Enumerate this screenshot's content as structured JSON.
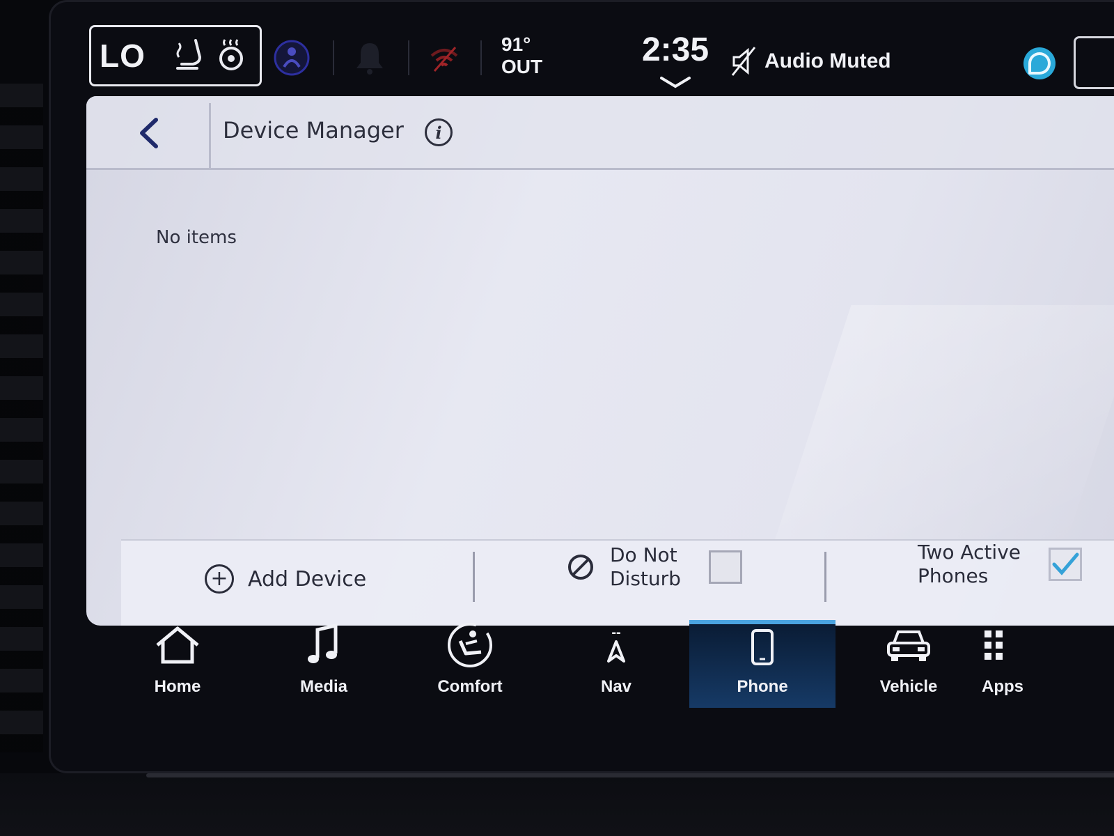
{
  "status_bar": {
    "climate_setting": "LO",
    "temperature": "91°",
    "temperature_label": "OUT",
    "time": "2:35",
    "audio_status": "Audio Muted",
    "icons": [
      "seat-heat-icon",
      "steering-wheel-heat-icon",
      "driver-assist-icon",
      "notification-bell-icon",
      "wifi-off-icon",
      "clock-expand-chevron-icon",
      "audio-muted-icon",
      "voice-assistant-icon"
    ]
  },
  "header": {
    "title": "Device Manager"
  },
  "content": {
    "empty_message": "No items"
  },
  "action_bar": {
    "add_device_label": "Add Device",
    "do_not_disturb_label": "Do Not Disturb",
    "do_not_disturb_checked": false,
    "two_active_phones_label": "Two Active Phones",
    "two_active_phones_checked": true
  },
  "nav": {
    "active": "Phone",
    "nav_top_text": "--",
    "items": [
      {
        "label": "Home",
        "icon": "home-icon"
      },
      {
        "label": "Media",
        "icon": "music-note-icon"
      },
      {
        "label": "Comfort",
        "icon": "seat-comfort-icon"
      },
      {
        "label": "Nav",
        "icon": "navigation-arrow-icon"
      },
      {
        "label": "Phone",
        "icon": "phone-icon"
      },
      {
        "label": "Vehicle",
        "icon": "car-icon"
      },
      {
        "label": "Apps",
        "icon": "apps-grid-icon"
      }
    ]
  },
  "colors": {
    "active_nav": "#163a66",
    "active_accent": "#4aa3e0",
    "assistant": "#2aa9d9",
    "panel_bg": "#e3e4ef",
    "checkbox_check": "#35a2d8"
  }
}
